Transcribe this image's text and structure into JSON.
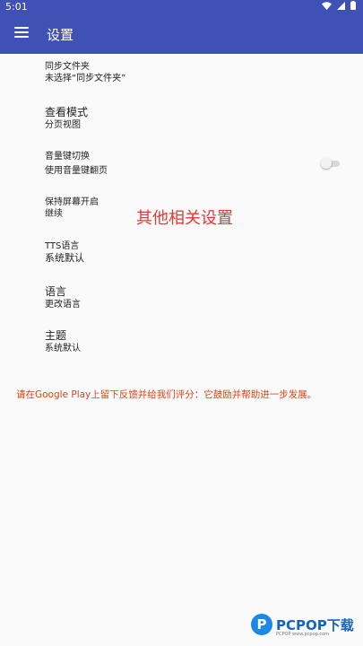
{
  "status": {
    "time": "5:01"
  },
  "appbar": {
    "title": "设置"
  },
  "settings": [
    {
      "title": "同步文件夹",
      "subtitle": "未选择“同步文件夹”"
    },
    {
      "title": "查看模式",
      "subtitle": "分页视图"
    },
    {
      "title": "音量键切换",
      "subtitle": "使用音量键翻页"
    },
    {
      "title": "保持屏幕开启",
      "subtitle": "继续"
    },
    {
      "title": "TTS语言",
      "subtitle": "系统默认"
    },
    {
      "title": "语言",
      "subtitle": "更改语言"
    },
    {
      "title": "主题",
      "subtitle": "系统默认"
    }
  ],
  "overlay_label": "其他相关设置",
  "footer": "请在Google Play上留下反馈并给我们评分：它鼓励并帮助进一步发展。",
  "logo": {
    "text": "PCPOP下载",
    "sub": "PCPOP www.pcpop.com"
  },
  "colors": {
    "primary": "#3f51b5",
    "accent_red": "#e53935"
  }
}
